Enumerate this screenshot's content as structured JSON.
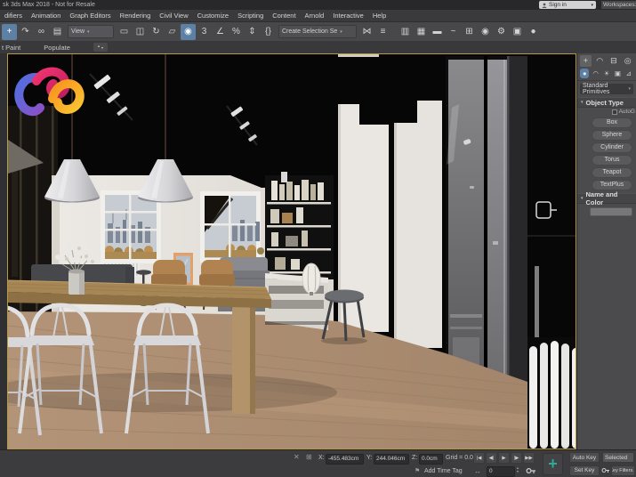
{
  "window": {
    "title": "sk 3ds Max 2018 - Not for Resale",
    "sign_in_label": "Sign in",
    "workspaces_label": "Workspaces: D"
  },
  "icons": {
    "caret_down": "▾",
    "flag": "⚑",
    "spinner_up": "▴",
    "spinner_down": "▾",
    "close": "✕",
    "grid_toggle": "⊞",
    "time_arrows": "↔",
    "ribbon_tab_media": "▪"
  },
  "menu": {
    "items": [
      "difiers",
      "Animation",
      "Graph Editors",
      "Rendering",
      "Civil View",
      "Customize",
      "Scripting",
      "Content",
      "Arnold",
      "Interactive",
      "Help"
    ]
  },
  "toolbar": {
    "view_dropdown_label": "View",
    "selection_set_label": "Create Selection Se",
    "icons_a": [
      {
        "name": "select-and-move-icon",
        "glyph": "+",
        "active": true
      },
      {
        "name": "redo-icon",
        "glyph": "↷"
      },
      {
        "name": "select-and-link-icon",
        "glyph": "∞"
      },
      {
        "name": "select-by-name-icon",
        "glyph": "▤"
      }
    ],
    "icons_b": [
      {
        "name": "selection-region-icon",
        "glyph": "▭"
      },
      {
        "name": "window-crossing-icon",
        "glyph": "◫"
      },
      {
        "name": "select-and-rotate-icon",
        "glyph": "↻"
      },
      {
        "name": "select-and-scale-icon",
        "glyph": "▱"
      },
      {
        "name": "use-pivot-icon",
        "glyph": "◉",
        "active": true
      },
      {
        "name": "snaps-toggle-icon",
        "glyph": "3"
      },
      {
        "name": "angle-snap-icon",
        "glyph": "∠"
      },
      {
        "name": "percent-snap-icon",
        "glyph": "%"
      },
      {
        "name": "spinner-snap-icon",
        "glyph": "⇕"
      },
      {
        "name": "named-selection-sets-icon",
        "glyph": "{}"
      }
    ],
    "icons_c": [
      {
        "name": "mirror-icon",
        "glyph": "⋈"
      },
      {
        "name": "align-icon",
        "glyph": "≡"
      }
    ],
    "icons_d": [
      {
        "name": "scene-explorer-icon",
        "glyph": "▥"
      },
      {
        "name": "layer-explorer-icon",
        "glyph": "▦"
      },
      {
        "name": "ribbon-toggle-icon",
        "glyph": "▬"
      },
      {
        "name": "curve-editor-icon",
        "glyph": "~"
      },
      {
        "name": "schematic-view-icon",
        "glyph": "⊞"
      },
      {
        "name": "material-editor-icon",
        "glyph": "◉"
      },
      {
        "name": "render-setup-icon",
        "glyph": "⚙"
      },
      {
        "name": "rendered-frame-icon",
        "glyph": "▣"
      },
      {
        "name": "render-icon",
        "glyph": "●"
      }
    ]
  },
  "ribbon": {
    "tabs": [
      "t Paint",
      "Populate"
    ]
  },
  "command_panel": {
    "tabs": [
      {
        "name": "create-tab-icon",
        "glyph": "+",
        "active": true
      },
      {
        "name": "modify-tab-icon",
        "glyph": "◠"
      },
      {
        "name": "hierarchy-tab-icon",
        "glyph": "⊟"
      },
      {
        "name": "motion-tab-icon",
        "glyph": "◎"
      }
    ],
    "categories": [
      {
        "name": "geometry-category-icon",
        "glyph": "●",
        "active": true
      },
      {
        "name": "shapes-category-icon",
        "glyph": "◠"
      },
      {
        "name": "lights-category-icon",
        "glyph": "☀"
      },
      {
        "name": "cameras-category-icon",
        "glyph": "▣"
      },
      {
        "name": "helpers-category-icon",
        "glyph": "⊿"
      }
    ],
    "primitives_dropdown": "Standard Primitives",
    "object_type_rollout": "Object Type",
    "autogrid_label": "AutoG",
    "object_buttons": [
      "Box",
      "Sphere",
      "Cylinder",
      "Torus",
      "Teapot",
      "TextPlus"
    ],
    "name_color_rollout": "Name and Color"
  },
  "status_bar": {
    "x_label": "X:",
    "x_value": "-455.483cm",
    "y_label": "Y:",
    "y_value": "244.046cm",
    "z_label": "Z:",
    "z_value": "0.0cm",
    "grid_label": "Grid = 0.0cm",
    "add_time_tag": "Add Time Tag",
    "frame_value": "0",
    "auto_key_label": "Auto Key",
    "set_key_label": "Set Key",
    "selected_label": "Selected",
    "key_filters_label": "Key Filters...",
    "playback": [
      {
        "name": "go-to-start-icon",
        "glyph": "|◀"
      },
      {
        "name": "previous-frame-icon",
        "glyph": "◀|"
      },
      {
        "name": "play-icon",
        "glyph": "▶"
      },
      {
        "name": "next-frame-icon",
        "glyph": "|▶"
      },
      {
        "name": "go-to-end-icon",
        "glyph": "▶▶"
      }
    ]
  },
  "colors": {
    "viewport_border": "#b89a3e",
    "active_tool": "#5d81a5",
    "teal_accent": "#2fa99c",
    "logo_blue": "#5a7be0",
    "logo_purple": "#8a52c8",
    "logo_pink": "#ee2a6a",
    "logo_orange": "#f6921e",
    "logo_yellow": "#fbc532"
  }
}
